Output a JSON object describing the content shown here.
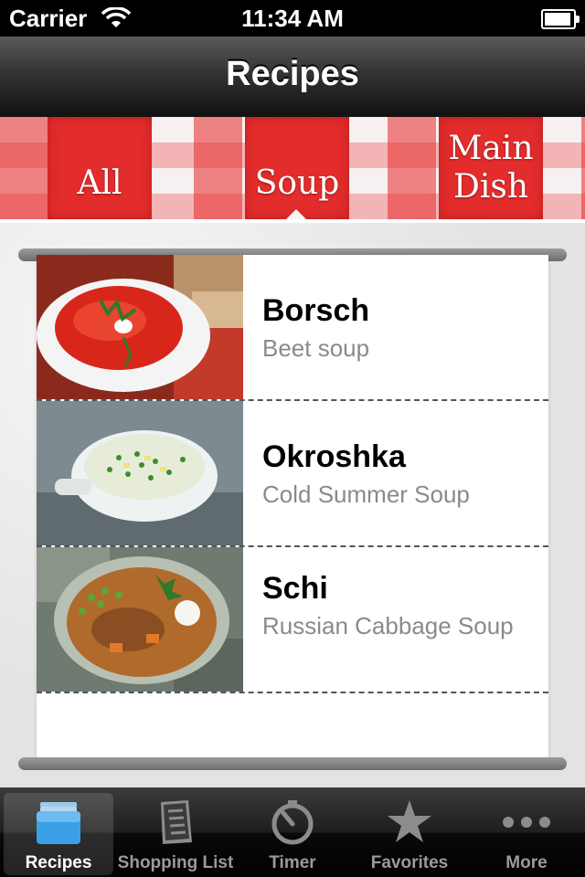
{
  "status_bar": {
    "carrier": "Carrier",
    "time": "11:34 AM"
  },
  "nav": {
    "title": "Recipes"
  },
  "categories": [
    {
      "label": "All"
    },
    {
      "label": "Soup",
      "selected": true
    },
    {
      "label_line1": "Main",
      "label_line2": "Dish"
    }
  ],
  "recipes": [
    {
      "title": "Borsch",
      "subtitle": "Beet soup"
    },
    {
      "title": "Okroshka",
      "subtitle": "Cold Summer Soup"
    },
    {
      "title": "Schi",
      "subtitle": "Russian Cabbage Soup"
    }
  ],
  "tab_bar": {
    "items": [
      {
        "label": "Recipes",
        "icon": "recipes-stack-icon",
        "active": true
      },
      {
        "label": "Shopping List",
        "icon": "shopping-list-icon"
      },
      {
        "label": "Timer",
        "icon": "timer-icon"
      },
      {
        "label": "Favorites",
        "icon": "star-icon"
      },
      {
        "label": "More",
        "icon": "more-dots-icon"
      }
    ]
  },
  "colors": {
    "accent_red": "#e32c2c",
    "tab_active_blue": "#3aa0e6",
    "subtitle_gray": "#8a8a8a"
  }
}
